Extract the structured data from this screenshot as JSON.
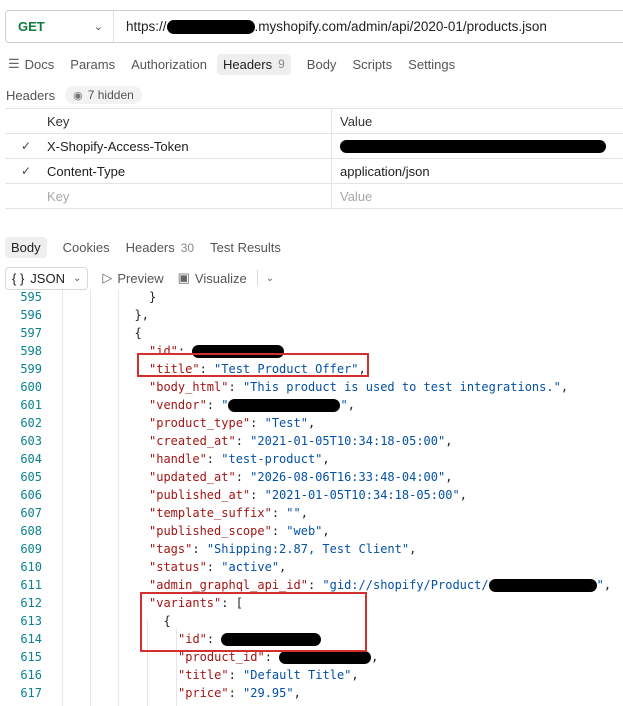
{
  "request": {
    "method": "GET",
    "url_prefix": "https://",
    "url_suffix": ".myshopify.com/admin/api/2020-01/products.json"
  },
  "request_tabs": [
    {
      "label": "Docs",
      "count": ""
    },
    {
      "label": "Params",
      "count": ""
    },
    {
      "label": "Authorization",
      "count": ""
    },
    {
      "label": "Headers",
      "count": "9"
    },
    {
      "label": "Body",
      "count": ""
    },
    {
      "label": "Scripts",
      "count": ""
    },
    {
      "label": "Settings",
      "count": ""
    }
  ],
  "headers_section": {
    "label": "Headers",
    "hidden": "7 hidden"
  },
  "headers_table": {
    "col_key": "Key",
    "col_value": "Value",
    "rows": [
      {
        "key": "X-Shopify-Access-Token",
        "value": ""
      },
      {
        "key": "Content-Type",
        "value": "application/json"
      }
    ],
    "placeholder_key": "Key",
    "placeholder_value": "Value"
  },
  "response_tabs": [
    {
      "label": "Body",
      "count": ""
    },
    {
      "label": "Cookies",
      "count": ""
    },
    {
      "label": "Headers",
      "count": "30"
    },
    {
      "label": "Test Results",
      "count": ""
    }
  ],
  "view": {
    "format": "JSON",
    "format_icon": "{ }",
    "preview": "Preview",
    "visualize": "Visualize"
  },
  "code_lines": [
    {
      "n": "595",
      "indent": 6,
      "parts": [
        [
          "p",
          "}"
        ]
      ]
    },
    {
      "n": "596",
      "indent": 5,
      "parts": [
        [
          "p",
          "},"
        ]
      ]
    },
    {
      "n": "597",
      "indent": 5,
      "parts": [
        [
          "p",
          "{"
        ]
      ]
    },
    {
      "n": "598",
      "indent": 6,
      "parts": [
        [
          "k",
          "\"id\""
        ],
        [
          "p",
          ": "
        ],
        [
          "r",
          ""
        ]
      ]
    },
    {
      "n": "599",
      "indent": 6,
      "parts": [
        [
          "k",
          "\"title\""
        ],
        [
          "p",
          ": "
        ],
        [
          "s",
          "\"Test Product Offer\""
        ],
        [
          "p",
          ","
        ]
      ]
    },
    {
      "n": "600",
      "indent": 6,
      "parts": [
        [
          "k",
          "\"body_html\""
        ],
        [
          "p",
          ": "
        ],
        [
          "s",
          "\"This product is used to test integrations.\""
        ],
        [
          "p",
          ","
        ]
      ]
    },
    {
      "n": "601",
      "indent": 6,
      "parts": [
        [
          "k",
          "\"vendor\""
        ],
        [
          "p",
          ": "
        ],
        [
          "s",
          "\""
        ],
        [
          "r",
          ""
        ],
        [
          "s",
          "\""
        ],
        [
          "p",
          ","
        ]
      ]
    },
    {
      "n": "602",
      "indent": 6,
      "parts": [
        [
          "k",
          "\"product_type\""
        ],
        [
          "p",
          ": "
        ],
        [
          "s",
          "\"Test\""
        ],
        [
          "p",
          ","
        ]
      ]
    },
    {
      "n": "603",
      "indent": 6,
      "parts": [
        [
          "k",
          "\"created_at\""
        ],
        [
          "p",
          ": "
        ],
        [
          "s",
          "\"2021-01-05T10:34:18-05:00\""
        ],
        [
          "p",
          ","
        ]
      ]
    },
    {
      "n": "604",
      "indent": 6,
      "parts": [
        [
          "k",
          "\"handle\""
        ],
        [
          "p",
          ": "
        ],
        [
          "s",
          "\"test-product\""
        ],
        [
          "p",
          ","
        ]
      ]
    },
    {
      "n": "605",
      "indent": 6,
      "parts": [
        [
          "k",
          "\"updated_at\""
        ],
        [
          "p",
          ": "
        ],
        [
          "s",
          "\"2026-08-06T16:33:48-04:00\""
        ],
        [
          "p",
          ","
        ]
      ]
    },
    {
      "n": "606",
      "indent": 6,
      "parts": [
        [
          "k",
          "\"published_at\""
        ],
        [
          "p",
          ": "
        ],
        [
          "s",
          "\"2021-01-05T10:34:18-05:00\""
        ],
        [
          "p",
          ","
        ]
      ]
    },
    {
      "n": "607",
      "indent": 6,
      "parts": [
        [
          "k",
          "\"template_suffix\""
        ],
        [
          "p",
          ": "
        ],
        [
          "s",
          "\"\""
        ],
        [
          "p",
          ","
        ]
      ]
    },
    {
      "n": "608",
      "indent": 6,
      "parts": [
        [
          "k",
          "\"published_scope\""
        ],
        [
          "p",
          ": "
        ],
        [
          "s",
          "\"web\""
        ],
        [
          "p",
          ","
        ]
      ]
    },
    {
      "n": "609",
      "indent": 6,
      "parts": [
        [
          "k",
          "\"tags\""
        ],
        [
          "p",
          ": "
        ],
        [
          "s",
          "\"Shipping:2.87, Test Client\""
        ],
        [
          "p",
          ","
        ]
      ]
    },
    {
      "n": "610",
      "indent": 6,
      "parts": [
        [
          "k",
          "\"status\""
        ],
        [
          "p",
          ": "
        ],
        [
          "s",
          "\"active\""
        ],
        [
          "p",
          ","
        ]
      ]
    },
    {
      "n": "611",
      "indent": 6,
      "parts": [
        [
          "k",
          "\"admin_graphql_api_id\""
        ],
        [
          "p",
          ": "
        ],
        [
          "s",
          "\"gid://shopify/Product/"
        ],
        [
          "r",
          ""
        ],
        [
          "s",
          "\""
        ],
        [
          "p",
          ","
        ]
      ]
    },
    {
      "n": "612",
      "indent": 6,
      "parts": [
        [
          "k",
          "\"variants\""
        ],
        [
          "p",
          ": ["
        ]
      ]
    },
    {
      "n": "613",
      "indent": 7,
      "parts": [
        [
          "p",
          "{"
        ]
      ]
    },
    {
      "n": "614",
      "indent": 8,
      "parts": [
        [
          "k",
          "\"id\""
        ],
        [
          "p",
          ": "
        ],
        [
          "r",
          ""
        ]
      ]
    },
    {
      "n": "615",
      "indent": 8,
      "parts": [
        [
          "k",
          "\"product_id\""
        ],
        [
          "p",
          ": "
        ],
        [
          "r",
          ""
        ],
        [
          "p",
          ","
        ]
      ]
    },
    {
      "n": "616",
      "indent": 8,
      "parts": [
        [
          "k",
          "\"title\""
        ],
        [
          "p",
          ": "
        ],
        [
          "s",
          "\"Default Title\""
        ],
        [
          "p",
          ","
        ]
      ]
    },
    {
      "n": "617",
      "indent": 8,
      "parts": [
        [
          "k",
          "\"price\""
        ],
        [
          "p",
          ": "
        ],
        [
          "s",
          "\"29.95\""
        ],
        [
          "p",
          ","
        ]
      ]
    }
  ]
}
